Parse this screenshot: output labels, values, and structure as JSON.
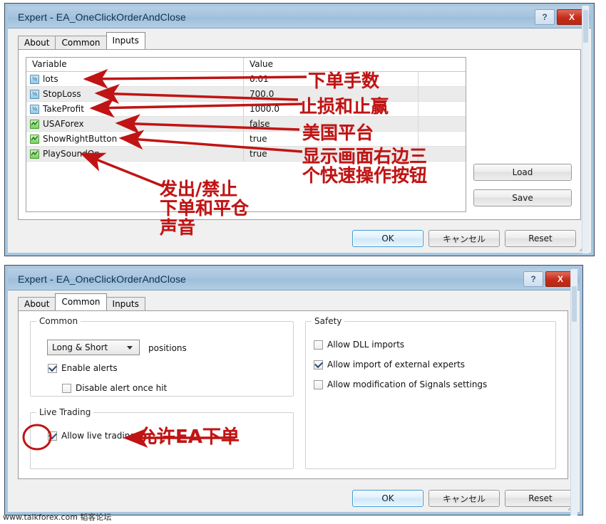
{
  "dialog1": {
    "title": "Expert - EA_OneClickOrderAndClose",
    "help_label": "?",
    "close_label": "X",
    "tabs": [
      {
        "label": "About",
        "active": false
      },
      {
        "label": "Common",
        "active": false
      },
      {
        "label": "Inputs",
        "active": true
      }
    ],
    "grid": {
      "columns": [
        "Variable",
        "Value"
      ],
      "rows": [
        {
          "icon": "numeric-variable-icon",
          "name": "lots",
          "value": "0.01"
        },
        {
          "icon": "numeric-variable-icon",
          "name": "StopLoss",
          "value": "700.0"
        },
        {
          "icon": "numeric-variable-icon",
          "name": "TakeProfit",
          "value": "1000.0"
        },
        {
          "icon": "boolean-variable-icon",
          "name": "USAForex",
          "value": "false"
        },
        {
          "icon": "boolean-variable-icon",
          "name": "ShowRightButton",
          "value": "true"
        },
        {
          "icon": "boolean-variable-icon",
          "name": "PlaySoundOn",
          "value": "true"
        }
      ]
    },
    "load_label": "Load",
    "save_label": "Save",
    "ok_label": "OK",
    "cancel_label": "キャンセル",
    "reset_label": "Reset"
  },
  "dialog2": {
    "title": "Expert - EA_OneClickOrderAndClose",
    "help_label": "?",
    "close_label": "X",
    "tabs": [
      {
        "label": "About",
        "active": false
      },
      {
        "label": "Common",
        "active": true
      },
      {
        "label": "Inputs",
        "active": false
      }
    ],
    "common_group": {
      "title": "Common",
      "positions_value": "Long & Short",
      "positions_label": "positions",
      "enable_alerts": {
        "label": "Enable alerts",
        "checked": true
      },
      "disable_alert_once_hit": {
        "label": "Disable alert once hit",
        "checked": false
      }
    },
    "live_trading_group": {
      "title": "Live Trading",
      "allow_live_trading": {
        "label": "Allow live trading",
        "checked": true
      }
    },
    "safety_group": {
      "title": "Safety",
      "allow_dll_imports": {
        "label": "Allow DLL imports",
        "checked": false
      },
      "allow_import_external_experts": {
        "label": "Allow import of external experts",
        "checked": true
      },
      "allow_modification_signals": {
        "label": "Allow modification of Signals settings",
        "checked": false
      }
    },
    "ok_label": "OK",
    "cancel_label": "キャンセル",
    "reset_label": "Reset"
  },
  "annotations": [
    {
      "id": "lots-note",
      "text": "下单手数"
    },
    {
      "id": "sl-tp-note",
      "text": "止损和止赢"
    },
    {
      "id": "usaforex-note",
      "text": "美国平台"
    },
    {
      "id": "showrightbutton-note",
      "text": "显示画面右边三\n个快速操作按钮"
    },
    {
      "id": "playsound-note",
      "text": "发出/禁止\n下单和平仓\n声音"
    },
    {
      "id": "livetrading-note",
      "text": "允许EA下单"
    }
  ],
  "watermark": {
    "text": "www.talkforex.com 韬客论坛"
  },
  "colors": {
    "annotation_red": "#c01414",
    "titlebar_blue": "#a6c4de",
    "close_red": "#c62a17",
    "default_button_border": "#3c9ad6"
  }
}
